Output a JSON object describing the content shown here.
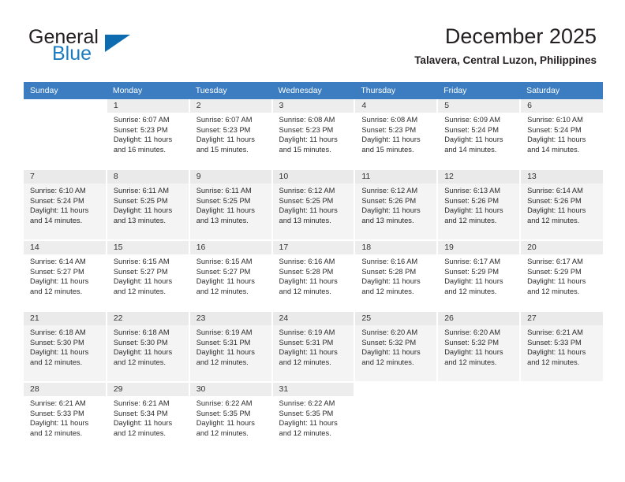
{
  "brand": {
    "name_part1": "General",
    "name_part2": "Blue"
  },
  "header": {
    "month_title": "December 2025",
    "location": "Talavera, Central Luzon, Philippines"
  },
  "colors": {
    "header_row": "#3b7dc0",
    "brand_blue": "#1b7bc1",
    "day_number_bg": "#ededed",
    "alt_row_bg": "#f4f4f4"
  },
  "weekdays": [
    "Sunday",
    "Monday",
    "Tuesday",
    "Wednesday",
    "Thursday",
    "Friday",
    "Saturday"
  ],
  "weeks": [
    [
      {
        "blank": true
      },
      {
        "day": "1",
        "sunrise": "Sunrise: 6:07 AM",
        "sunset": "Sunset: 5:23 PM",
        "daylight1": "Daylight: 11 hours",
        "daylight2": "and 16 minutes."
      },
      {
        "day": "2",
        "sunrise": "Sunrise: 6:07 AM",
        "sunset": "Sunset: 5:23 PM",
        "daylight1": "Daylight: 11 hours",
        "daylight2": "and 15 minutes."
      },
      {
        "day": "3",
        "sunrise": "Sunrise: 6:08 AM",
        "sunset": "Sunset: 5:23 PM",
        "daylight1": "Daylight: 11 hours",
        "daylight2": "and 15 minutes."
      },
      {
        "day": "4",
        "sunrise": "Sunrise: 6:08 AM",
        "sunset": "Sunset: 5:23 PM",
        "daylight1": "Daylight: 11 hours",
        "daylight2": "and 15 minutes."
      },
      {
        "day": "5",
        "sunrise": "Sunrise: 6:09 AM",
        "sunset": "Sunset: 5:24 PM",
        "daylight1": "Daylight: 11 hours",
        "daylight2": "and 14 minutes."
      },
      {
        "day": "6",
        "sunrise": "Sunrise: 6:10 AM",
        "sunset": "Sunset: 5:24 PM",
        "daylight1": "Daylight: 11 hours",
        "daylight2": "and 14 minutes."
      }
    ],
    [
      {
        "day": "7",
        "sunrise": "Sunrise: 6:10 AM",
        "sunset": "Sunset: 5:24 PM",
        "daylight1": "Daylight: 11 hours",
        "daylight2": "and 14 minutes."
      },
      {
        "day": "8",
        "sunrise": "Sunrise: 6:11 AM",
        "sunset": "Sunset: 5:25 PM",
        "daylight1": "Daylight: 11 hours",
        "daylight2": "and 13 minutes."
      },
      {
        "day": "9",
        "sunrise": "Sunrise: 6:11 AM",
        "sunset": "Sunset: 5:25 PM",
        "daylight1": "Daylight: 11 hours",
        "daylight2": "and 13 minutes."
      },
      {
        "day": "10",
        "sunrise": "Sunrise: 6:12 AM",
        "sunset": "Sunset: 5:25 PM",
        "daylight1": "Daylight: 11 hours",
        "daylight2": "and 13 minutes."
      },
      {
        "day": "11",
        "sunrise": "Sunrise: 6:12 AM",
        "sunset": "Sunset: 5:26 PM",
        "daylight1": "Daylight: 11 hours",
        "daylight2": "and 13 minutes."
      },
      {
        "day": "12",
        "sunrise": "Sunrise: 6:13 AM",
        "sunset": "Sunset: 5:26 PM",
        "daylight1": "Daylight: 11 hours",
        "daylight2": "and 12 minutes."
      },
      {
        "day": "13",
        "sunrise": "Sunrise: 6:14 AM",
        "sunset": "Sunset: 5:26 PM",
        "daylight1": "Daylight: 11 hours",
        "daylight2": "and 12 minutes."
      }
    ],
    [
      {
        "day": "14",
        "sunrise": "Sunrise: 6:14 AM",
        "sunset": "Sunset: 5:27 PM",
        "daylight1": "Daylight: 11 hours",
        "daylight2": "and 12 minutes."
      },
      {
        "day": "15",
        "sunrise": "Sunrise: 6:15 AM",
        "sunset": "Sunset: 5:27 PM",
        "daylight1": "Daylight: 11 hours",
        "daylight2": "and 12 minutes."
      },
      {
        "day": "16",
        "sunrise": "Sunrise: 6:15 AM",
        "sunset": "Sunset: 5:27 PM",
        "daylight1": "Daylight: 11 hours",
        "daylight2": "and 12 minutes."
      },
      {
        "day": "17",
        "sunrise": "Sunrise: 6:16 AM",
        "sunset": "Sunset: 5:28 PM",
        "daylight1": "Daylight: 11 hours",
        "daylight2": "and 12 minutes."
      },
      {
        "day": "18",
        "sunrise": "Sunrise: 6:16 AM",
        "sunset": "Sunset: 5:28 PM",
        "daylight1": "Daylight: 11 hours",
        "daylight2": "and 12 minutes."
      },
      {
        "day": "19",
        "sunrise": "Sunrise: 6:17 AM",
        "sunset": "Sunset: 5:29 PM",
        "daylight1": "Daylight: 11 hours",
        "daylight2": "and 12 minutes."
      },
      {
        "day": "20",
        "sunrise": "Sunrise: 6:17 AM",
        "sunset": "Sunset: 5:29 PM",
        "daylight1": "Daylight: 11 hours",
        "daylight2": "and 12 minutes."
      }
    ],
    [
      {
        "day": "21",
        "sunrise": "Sunrise: 6:18 AM",
        "sunset": "Sunset: 5:30 PM",
        "daylight1": "Daylight: 11 hours",
        "daylight2": "and 12 minutes."
      },
      {
        "day": "22",
        "sunrise": "Sunrise: 6:18 AM",
        "sunset": "Sunset: 5:30 PM",
        "daylight1": "Daylight: 11 hours",
        "daylight2": "and 12 minutes."
      },
      {
        "day": "23",
        "sunrise": "Sunrise: 6:19 AM",
        "sunset": "Sunset: 5:31 PM",
        "daylight1": "Daylight: 11 hours",
        "daylight2": "and 12 minutes."
      },
      {
        "day": "24",
        "sunrise": "Sunrise: 6:19 AM",
        "sunset": "Sunset: 5:31 PM",
        "daylight1": "Daylight: 11 hours",
        "daylight2": "and 12 minutes."
      },
      {
        "day": "25",
        "sunrise": "Sunrise: 6:20 AM",
        "sunset": "Sunset: 5:32 PM",
        "daylight1": "Daylight: 11 hours",
        "daylight2": "and 12 minutes."
      },
      {
        "day": "26",
        "sunrise": "Sunrise: 6:20 AM",
        "sunset": "Sunset: 5:32 PM",
        "daylight1": "Daylight: 11 hours",
        "daylight2": "and 12 minutes."
      },
      {
        "day": "27",
        "sunrise": "Sunrise: 6:21 AM",
        "sunset": "Sunset: 5:33 PM",
        "daylight1": "Daylight: 11 hours",
        "daylight2": "and 12 minutes."
      }
    ],
    [
      {
        "day": "28",
        "sunrise": "Sunrise: 6:21 AM",
        "sunset": "Sunset: 5:33 PM",
        "daylight1": "Daylight: 11 hours",
        "daylight2": "and 12 minutes."
      },
      {
        "day": "29",
        "sunrise": "Sunrise: 6:21 AM",
        "sunset": "Sunset: 5:34 PM",
        "daylight1": "Daylight: 11 hours",
        "daylight2": "and 12 minutes."
      },
      {
        "day": "30",
        "sunrise": "Sunrise: 6:22 AM",
        "sunset": "Sunset: 5:35 PM",
        "daylight1": "Daylight: 11 hours",
        "daylight2": "and 12 minutes."
      },
      {
        "day": "31",
        "sunrise": "Sunrise: 6:22 AM",
        "sunset": "Sunset: 5:35 PM",
        "daylight1": "Daylight: 11 hours",
        "daylight2": "and 12 minutes."
      },
      {
        "blank": true
      },
      {
        "blank": true
      },
      {
        "blank": true
      }
    ]
  ]
}
